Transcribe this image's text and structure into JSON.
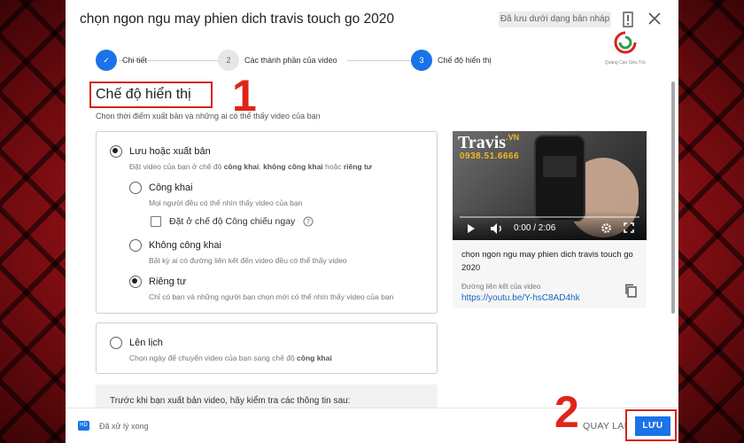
{
  "header": {
    "title": "chọn ngon ngu may phien dich travis touch go 2020",
    "draft_badge": "Đã lưu dưới dạng bản nháp"
  },
  "stepper": {
    "steps": [
      {
        "label": "Chi tiết",
        "number": "✓",
        "state": "done"
      },
      {
        "label": "Các thành phần của video",
        "number": "2",
        "state": "idle"
      },
      {
        "label": "Chế độ hiển thị",
        "number": "3",
        "state": "active"
      }
    ]
  },
  "logo": {
    "text": "Quảng Cáo Siêu Tốc"
  },
  "annotations": {
    "one": "1",
    "two": "2"
  },
  "section": {
    "title": "Chế độ hiển thị",
    "subtitle": "Chọn thời điểm xuất bản và những ai có thể thấy video của bạn"
  },
  "publish": {
    "label": "Lưu hoặc xuất bản",
    "desc_prefix": "Đặt video của bạn ở chế độ ",
    "desc_bold1": "công khai",
    "desc_mid": ", ",
    "desc_bold2": "không công khai",
    "desc_mid2": " hoặc ",
    "desc_bold3": "riêng tư",
    "options": {
      "public": {
        "label": "Công khai",
        "desc": "Mọi người đều có thể nhìn thấy video của bạn"
      },
      "premiere": {
        "label": "Đặt ở chế độ Công chiếu ngay"
      },
      "unlisted": {
        "label": "Không công khai",
        "desc": "Bất kỳ ai có đường liên kết đến video đều có thể thấy video"
      },
      "private": {
        "label": "Riêng tư",
        "desc": "Chỉ có bạn và những người bạn chọn mới có thể nhìn thấy video của bạn"
      }
    }
  },
  "schedule": {
    "label": "Lên lịch",
    "desc_prefix": "Chọn ngày để chuyển video của bạn sang chế độ ",
    "desc_bold": "công khai"
  },
  "checklist": {
    "text": "Trước khi bạn xuất bản video, hãy kiểm tra các thông tin sau:"
  },
  "video": {
    "brand": "Travis",
    "brand_suffix": ".VN",
    "phone": "0938.51.6666",
    "time": "0:00 / 2:06",
    "title": "chọn ngon ngu may phien dich travis touch go 2020",
    "link_label": "Đường liên kết của video",
    "link_url": "https://youtu.be/Y-hsC8AD4hk",
    "progress": 0
  },
  "footer": {
    "status": "Đã xử lý xong",
    "hd_badge": "HD",
    "back_label": "QUAY LẠI",
    "save_label": "LƯU"
  },
  "colors": {
    "accent": "#1a73e8",
    "annotation": "#d8231a"
  }
}
